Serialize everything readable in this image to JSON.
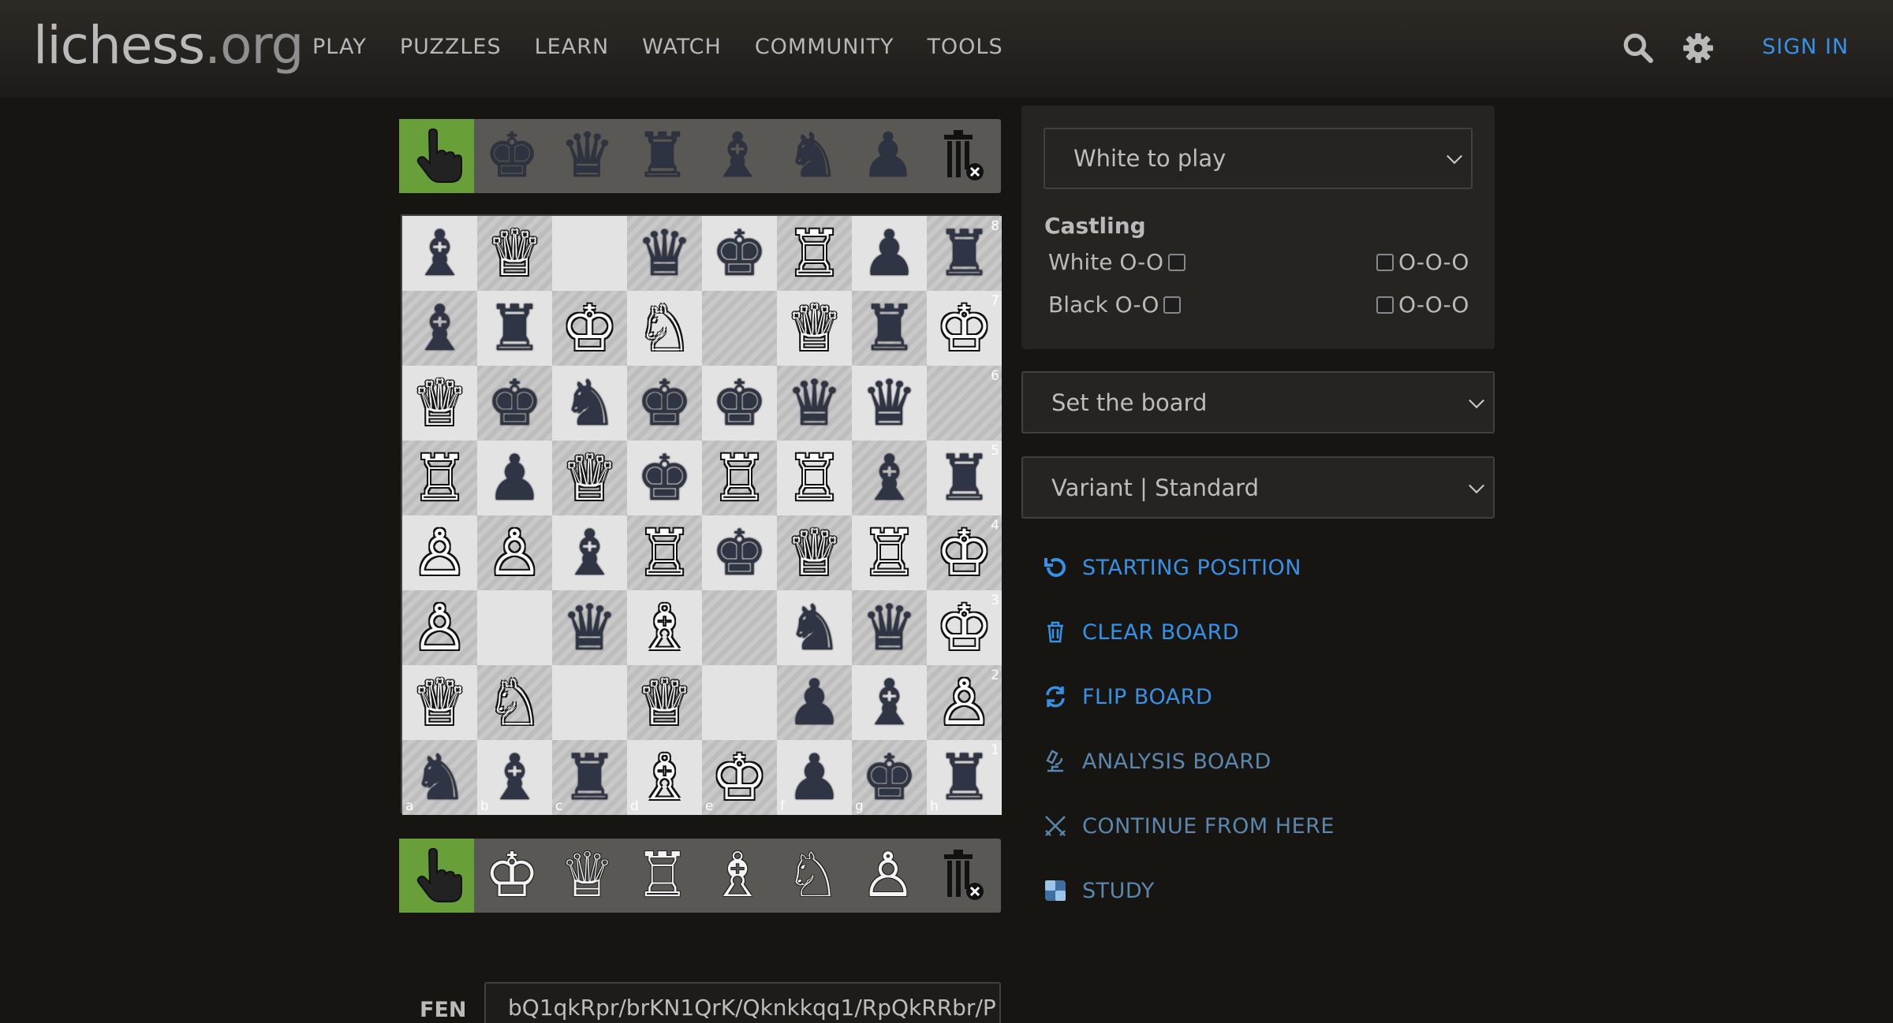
{
  "header": {
    "logo_main": "lichess",
    "logo_tld": ".org",
    "nav": [
      "PLAY",
      "PUZZLES",
      "LEARN",
      "WATCH",
      "COMMUNITY",
      "TOOLS"
    ],
    "sign_in": "SIGN IN"
  },
  "spare_top": {
    "pieces": [
      "♚",
      "♛",
      "♜",
      "♝",
      "♞",
      "♟"
    ]
  },
  "spare_bottom": {
    "pieces": [
      "♔",
      "♕",
      "♖",
      "♗",
      "♘",
      "♙"
    ]
  },
  "board": {
    "rows": [
      [
        "b",
        "Q",
        "",
        "q",
        "k",
        "R",
        "p",
        "r"
      ],
      [
        "b",
        "r",
        "K",
        "N",
        "",
        "Q",
        "r",
        "K"
      ],
      [
        "Q",
        "k",
        "n",
        "k",
        "k",
        "q",
        "q",
        ""
      ],
      [
        "R",
        "p",
        "Q",
        "k",
        "R",
        "R",
        "b",
        "r"
      ],
      [
        "P",
        "P",
        "b",
        "R",
        "k",
        "Q",
        "R",
        "K"
      ],
      [
        "P",
        "",
        "q",
        "B",
        "",
        "n",
        "q",
        "K"
      ],
      [
        "Q",
        "N",
        "",
        "Q",
        "",
        "p",
        "b",
        "P"
      ],
      [
        "n",
        "b",
        "r",
        "B",
        "K",
        "p",
        "k",
        "r"
      ]
    ],
    "ranks": [
      "8",
      "7",
      "6",
      "5",
      "4",
      "3",
      "2",
      "1"
    ],
    "files": [
      "a",
      "b",
      "c",
      "d",
      "e",
      "f",
      "g",
      "h"
    ]
  },
  "panel": {
    "turn": "White to play",
    "castling_title": "Castling",
    "white_oo": "White O-O",
    "white_ooo": "O-O-O",
    "black_oo": "Black O-O",
    "black_ooo": "O-O-O"
  },
  "setup_select": "Set the board",
  "variant_select": "Variant | Standard",
  "actions": {
    "starting": "STARTING POSITION",
    "clear": "CLEAR BOARD",
    "flip": "FLIP BOARD",
    "analysis": "ANALYSIS BOARD",
    "continue": "CONTINUE FROM HERE",
    "study": "STUDY"
  },
  "fen": {
    "label": "FEN",
    "value": "bQ1qkRpr/brKN1QrK/Qknkkqq1/RpQkRRbr/P"
  },
  "colors": {
    "accent": "#3692e7",
    "selected": "#689f38",
    "background": "#161512"
  }
}
